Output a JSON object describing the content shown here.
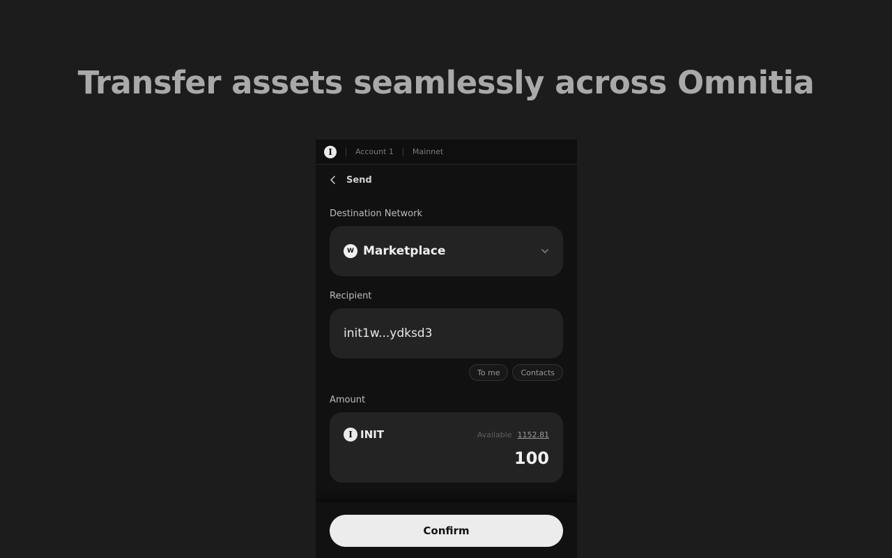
{
  "headline": "Transfer assets seamlessly across Omnitia",
  "topbar": {
    "logo_glyph": "I",
    "account": "Account 1",
    "network": "Mainnet"
  },
  "nav": {
    "title": "Send"
  },
  "destination": {
    "label": "Destination Network",
    "icon_glyph": "W",
    "value": "Marketplace"
  },
  "recipient": {
    "label": "Recipient",
    "value": "init1w...ydksd3",
    "shortcuts": [
      "To me",
      "Contacts"
    ]
  },
  "amount": {
    "label": "Amount",
    "token_glyph": "I",
    "token": "INIT",
    "available_label": "Available",
    "available_value": "1152.81",
    "value": "100"
  },
  "confirm_label": "Confirm"
}
